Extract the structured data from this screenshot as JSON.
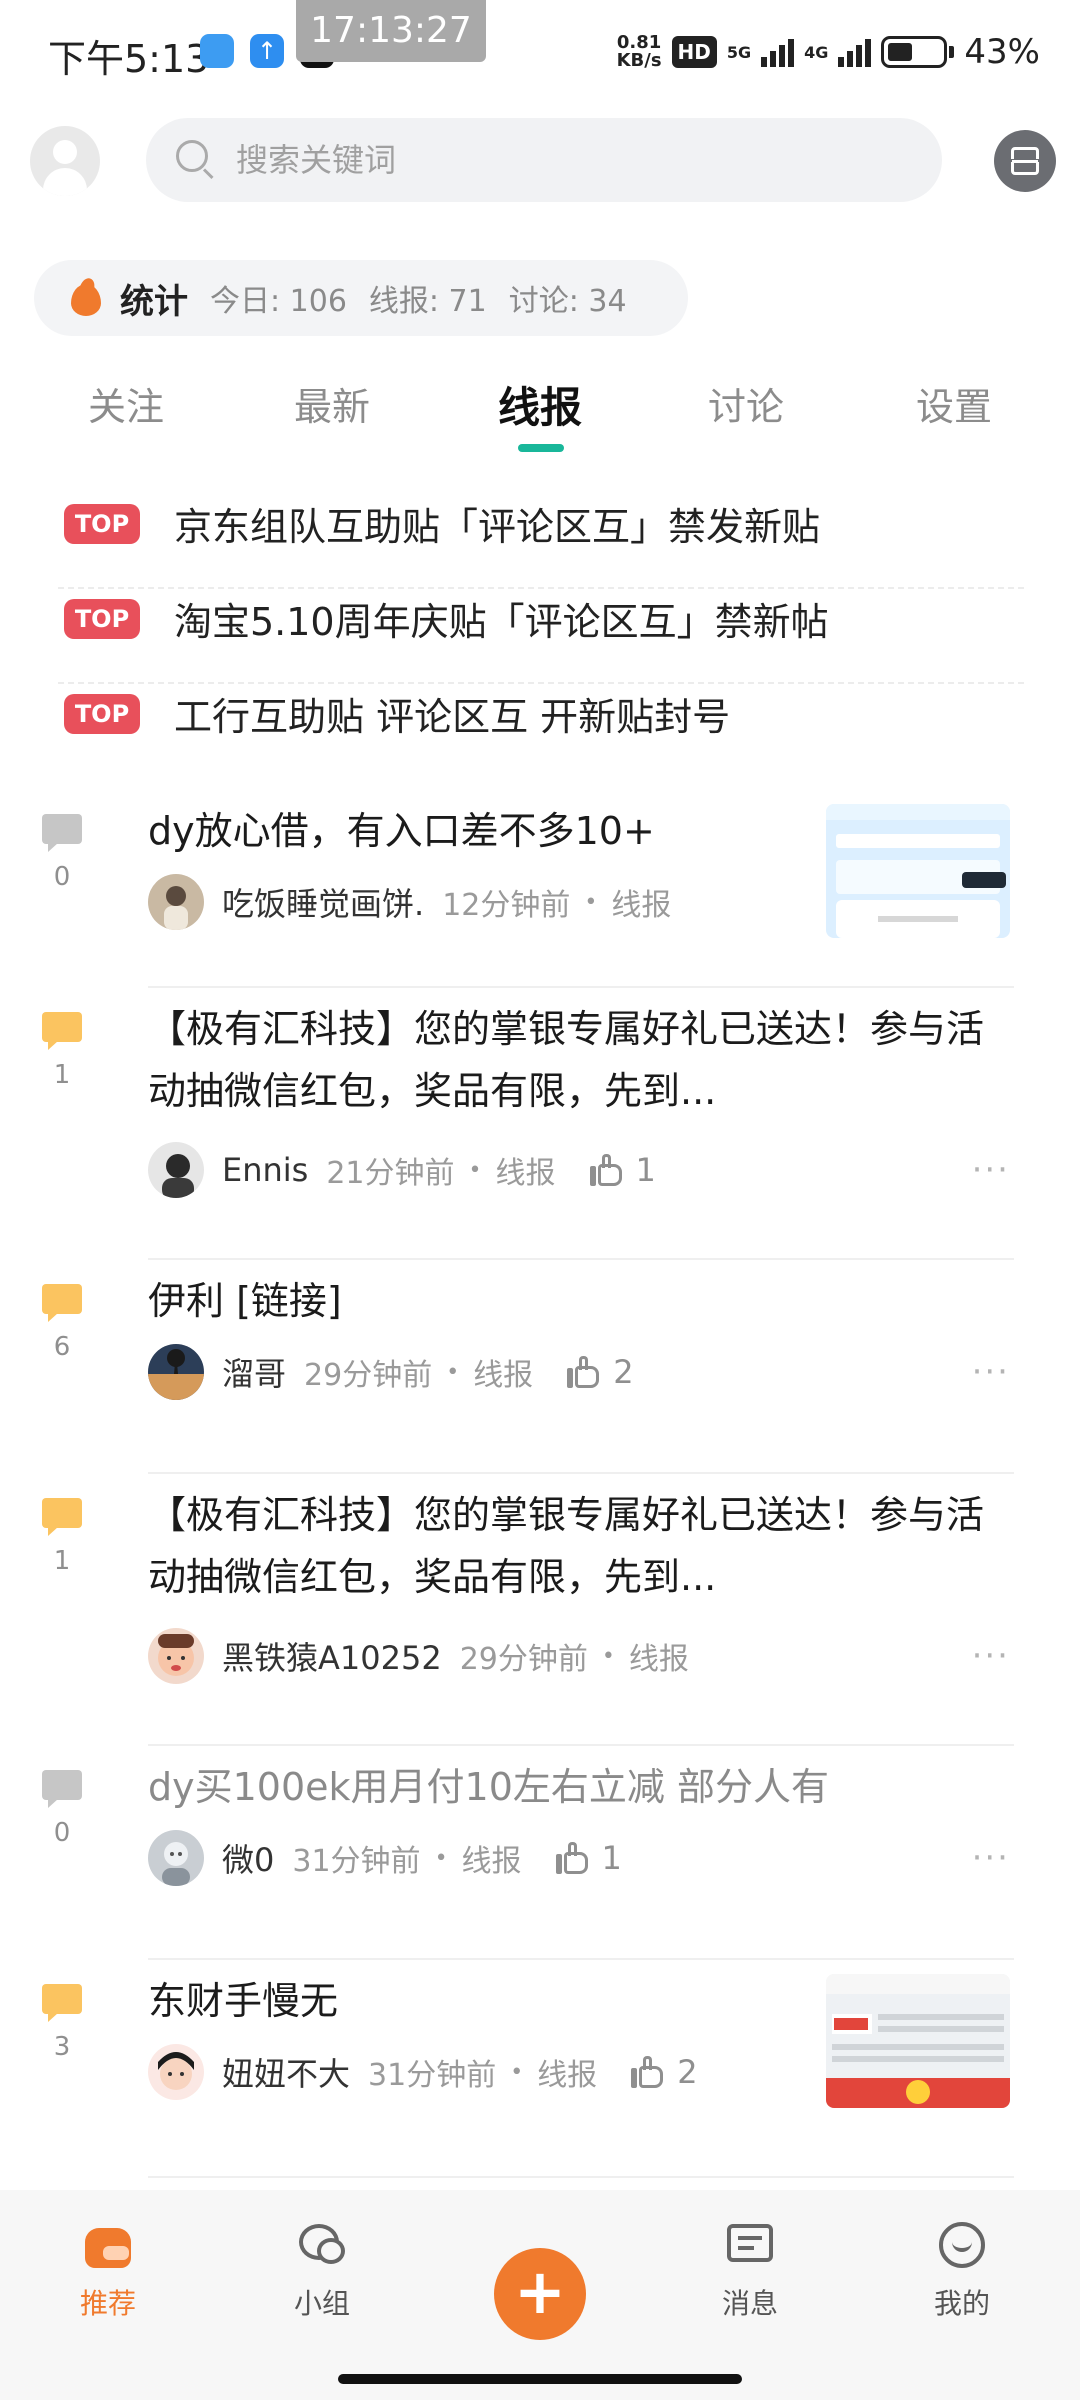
{
  "status_bar": {
    "time": "下午5:13",
    "clock_chip": "17:13:27",
    "speed_value": "0.81",
    "speed_unit": "KB/s",
    "hd_label": "HD",
    "net1": "5G",
    "net2": "4G",
    "battery_pct": "43%",
    "icons": [
      "cloud-app-icon",
      "upload-app-icon",
      "tiktok-icon",
      "signal-icon",
      "battery-icon"
    ]
  },
  "search": {
    "placeholder": "搜索关键词"
  },
  "stats": {
    "title": "统计",
    "today": "今日: 106",
    "xianbao": "线报: 71",
    "discuss": "讨论: 34"
  },
  "tabs": [
    "关注",
    "最新",
    "线报",
    "讨论",
    "设置"
  ],
  "active_tab": "线报",
  "pinned": {
    "badge": "TOP",
    "items": [
      "京东组队互助贴「评论区互」禁发新贴",
      "淘宝5.10周年庆贴「评论区互」禁新帖",
      "工行互助贴 评论区互 开新贴封号"
    ]
  },
  "posts": [
    {
      "title": "dy放心借，有入口差不多10+",
      "replies": "0",
      "user": "吃饭睡觉画饼.",
      "time": "12分钟前",
      "category": "线报",
      "likes": "",
      "has_image": true,
      "read": false
    },
    {
      "title": "【极有汇科技】您的掌银专属好礼已送达！参与活动抽微信红包，奖品有限，先到...",
      "replies": "1",
      "user": "Ennis",
      "time": "21分钟前",
      "category": "线报",
      "likes": "1",
      "has_image": false,
      "read": false
    },
    {
      "title": "伊利 [链接]",
      "replies": "6",
      "user": "溜哥",
      "time": "29分钟前",
      "category": "线报",
      "likes": "2",
      "has_image": false,
      "read": false
    },
    {
      "title": "【极有汇科技】您的掌银专属好礼已送达！参与活动抽微信红包，奖品有限，先到...",
      "replies": "1",
      "user": "黑铁猿A10252",
      "time": "29分钟前",
      "category": "线报",
      "likes": "",
      "has_image": false,
      "read": false
    },
    {
      "title": "dy买100ek用月付10左右立减 部分人有",
      "replies": "0",
      "user": "微0",
      "time": "31分钟前",
      "category": "线报",
      "likes": "1",
      "has_image": false,
      "read": true
    },
    {
      "title": "东财手慢无",
      "replies": "3",
      "user": "妞妞不大",
      "time": "31分钟前",
      "category": "线报",
      "likes": "2",
      "has_image": true,
      "read": false
    }
  ],
  "separator": "•",
  "more_glyph": "···",
  "bottom_nav": {
    "home": "推荐",
    "group": "小组",
    "post_plus": "+",
    "messages": "消息",
    "me": "我的"
  },
  "colors": {
    "accent": "#f07a2d",
    "tab_underline": "#19b79a",
    "top_badge": "#e8505b",
    "hot_bubble": "#fbc460"
  }
}
